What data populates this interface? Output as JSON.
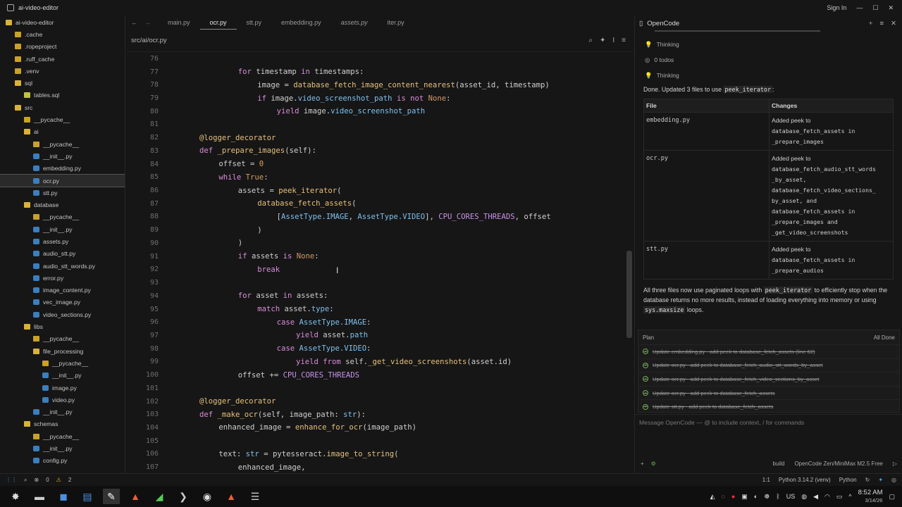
{
  "window": {
    "title": "ai-video-editor",
    "sign_in": "Sign In"
  },
  "sidebar": {
    "items": [
      {
        "label": "ai-video-editor",
        "indent": 0,
        "icon": "folder-open-icon"
      },
      {
        "label": ".cache",
        "indent": 1,
        "icon": "folder-icon"
      },
      {
        "label": ".ropeproject",
        "indent": 1,
        "icon": "folder-icon"
      },
      {
        "label": ".ruff_cache",
        "indent": 1,
        "icon": "folder-icon"
      },
      {
        "label": ".venv",
        "indent": 1,
        "icon": "folder-icon"
      },
      {
        "label": "sql",
        "indent": 1,
        "icon": "folder-open-icon"
      },
      {
        "label": "tables.sql",
        "indent": 2,
        "icon": "sql-file-icon"
      },
      {
        "label": "src",
        "indent": 1,
        "icon": "folder-open-icon"
      },
      {
        "label": "__pycache__",
        "indent": 2,
        "icon": "folder-icon"
      },
      {
        "label": "ai",
        "indent": 2,
        "icon": "folder-open-icon"
      },
      {
        "label": "__pycache__",
        "indent": 3,
        "icon": "folder-icon"
      },
      {
        "label": "__init__.py",
        "indent": 3,
        "icon": "python-file-icon"
      },
      {
        "label": "embedding.py",
        "indent": 3,
        "icon": "python-file-icon"
      },
      {
        "label": "ocr.py",
        "indent": 3,
        "icon": "python-file-icon",
        "selected": true
      },
      {
        "label": "stt.py",
        "indent": 3,
        "icon": "python-file-icon"
      },
      {
        "label": "database",
        "indent": 2,
        "icon": "folder-open-icon"
      },
      {
        "label": "__pycache__",
        "indent": 3,
        "icon": "folder-icon"
      },
      {
        "label": "__init__.py",
        "indent": 3,
        "icon": "python-file-icon"
      },
      {
        "label": "assets.py",
        "indent": 3,
        "icon": "python-file-icon"
      },
      {
        "label": "audio_stt.py",
        "indent": 3,
        "icon": "python-file-icon"
      },
      {
        "label": "audio_stt_words.py",
        "indent": 3,
        "icon": "python-file-icon"
      },
      {
        "label": "error.py",
        "indent": 3,
        "icon": "python-file-icon"
      },
      {
        "label": "image_content.py",
        "indent": 3,
        "icon": "python-file-icon"
      },
      {
        "label": "vec_image.py",
        "indent": 3,
        "icon": "python-file-icon"
      },
      {
        "label": "video_sections.py",
        "indent": 3,
        "icon": "python-file-icon"
      },
      {
        "label": "libs",
        "indent": 2,
        "icon": "folder-open-icon"
      },
      {
        "label": "__pycache__",
        "indent": 3,
        "icon": "folder-icon"
      },
      {
        "label": "file_processing",
        "indent": 3,
        "icon": "folder-open-icon"
      },
      {
        "label": "__pycache__",
        "indent": 4,
        "icon": "folder-icon"
      },
      {
        "label": "__init__.py",
        "indent": 4,
        "icon": "python-file-icon"
      },
      {
        "label": "image.py",
        "indent": 4,
        "icon": "python-file-icon"
      },
      {
        "label": "video.py",
        "indent": 4,
        "icon": "python-file-icon"
      },
      {
        "label": "__init__.py",
        "indent": 3,
        "icon": "python-file-icon"
      },
      {
        "label": "schemas",
        "indent": 2,
        "icon": "folder-open-icon"
      },
      {
        "label": "__pycache__",
        "indent": 3,
        "icon": "folder-icon"
      },
      {
        "label": "__init__.py",
        "indent": 3,
        "icon": "python-file-icon"
      },
      {
        "label": "config.py",
        "indent": 3,
        "icon": "python-file-icon"
      }
    ]
  },
  "tabs": [
    {
      "label": "main.py",
      "active": false,
      "italic": false
    },
    {
      "label": "ocr.py",
      "active": true,
      "italic": false
    },
    {
      "label": "stt.py",
      "active": false,
      "italic": false
    },
    {
      "label": "embedding.py",
      "active": false,
      "italic": false
    },
    {
      "label": "assets.py",
      "active": false,
      "italic": true
    },
    {
      "label": "iter.py",
      "active": false,
      "italic": false
    }
  ],
  "breadcrumb": "src/ai/ocr.py",
  "code": [
    {
      "n": "76",
      "indent": 0,
      "tokens": []
    },
    {
      "n": "77",
      "indent": 3,
      "tokens": [
        [
          "k",
          "for "
        ],
        [
          "v",
          "timestamp "
        ],
        [
          "k",
          "in "
        ],
        [
          "v",
          "timestamps:"
        ]
      ]
    },
    {
      "n": "78",
      "indent": 4,
      "tokens": [
        [
          "v",
          "image = "
        ],
        [
          "f",
          "database_fetch_image_content_nearest"
        ],
        [
          "v",
          "(asset_id, timestamp)"
        ]
      ]
    },
    {
      "n": "79",
      "indent": 4,
      "tokens": [
        [
          "k",
          "if "
        ],
        [
          "v",
          "image."
        ],
        [
          "t",
          "video_screenshot_path "
        ],
        [
          "k",
          "is not "
        ],
        [
          "c",
          "None"
        ],
        [
          "v",
          ":"
        ]
      ]
    },
    {
      "n": "80",
      "indent": 5,
      "tokens": [
        [
          "k",
          "yield "
        ],
        [
          "v",
          "image."
        ],
        [
          "t",
          "video_screenshot_path"
        ]
      ]
    },
    {
      "n": "81",
      "indent": 0,
      "tokens": []
    },
    {
      "n": "82",
      "indent": 1,
      "tokens": [
        [
          "d",
          "@logger_decorator"
        ]
      ]
    },
    {
      "n": "83",
      "indent": 1,
      "tokens": [
        [
          "k",
          "def "
        ],
        [
          "f",
          "_prepare_images"
        ],
        [
          "v",
          "(self):"
        ]
      ]
    },
    {
      "n": "84",
      "indent": 2,
      "tokens": [
        [
          "v",
          "offset = "
        ],
        [
          "n",
          "0"
        ]
      ]
    },
    {
      "n": "85",
      "indent": 2,
      "tokens": [
        [
          "k",
          "while "
        ],
        [
          "c",
          "True"
        ],
        [
          "v",
          ":"
        ]
      ]
    },
    {
      "n": "86",
      "indent": 3,
      "tokens": [
        [
          "v",
          "assets = "
        ],
        [
          "f",
          "peek_iterator"
        ],
        [
          "v",
          "("
        ]
      ]
    },
    {
      "n": "87",
      "indent": 4,
      "tokens": [
        [
          "f",
          "database_fetch_assets"
        ],
        [
          "v",
          "("
        ]
      ]
    },
    {
      "n": "88",
      "indent": 5,
      "tokens": [
        [
          "v",
          "["
        ],
        [
          "t",
          "AssetType.IMAGE"
        ],
        [
          "v",
          ", "
        ],
        [
          "t",
          "AssetType.VIDEO"
        ],
        [
          "v",
          "], "
        ],
        [
          "p",
          "CPU_CORES_THREADS"
        ],
        [
          "v",
          ", offset"
        ]
      ]
    },
    {
      "n": "89",
      "indent": 4,
      "tokens": [
        [
          "v",
          ")"
        ]
      ]
    },
    {
      "n": "90",
      "indent": 3,
      "tokens": [
        [
          "v",
          ")"
        ]
      ]
    },
    {
      "n": "91",
      "indent": 3,
      "tokens": [
        [
          "k",
          "if "
        ],
        [
          "v",
          "assets "
        ],
        [
          "k",
          "is "
        ],
        [
          "c",
          "None"
        ],
        [
          "v",
          ":"
        ]
      ]
    },
    {
      "n": "92",
      "indent": 4,
      "tokens": [
        [
          "k",
          "break"
        ]
      ]
    },
    {
      "n": "93",
      "indent": 0,
      "tokens": []
    },
    {
      "n": "94",
      "indent": 3,
      "tokens": [
        [
          "k",
          "for "
        ],
        [
          "v",
          "asset "
        ],
        [
          "k",
          "in "
        ],
        [
          "v",
          "assets:"
        ]
      ]
    },
    {
      "n": "95",
      "indent": 4,
      "tokens": [
        [
          "k",
          "match "
        ],
        [
          "v",
          "asset."
        ],
        [
          "t",
          "type"
        ],
        [
          "v",
          ":"
        ]
      ]
    },
    {
      "n": "96",
      "indent": 5,
      "tokens": [
        [
          "k",
          "case "
        ],
        [
          "t",
          "AssetType.IMAGE"
        ],
        [
          "v",
          ":"
        ]
      ]
    },
    {
      "n": "97",
      "indent": 6,
      "tokens": [
        [
          "k",
          "yield "
        ],
        [
          "v",
          "asset."
        ],
        [
          "t",
          "path"
        ]
      ]
    },
    {
      "n": "98",
      "indent": 5,
      "tokens": [
        [
          "k",
          "case "
        ],
        [
          "t",
          "AssetType.VIDEO"
        ],
        [
          "v",
          ":"
        ]
      ]
    },
    {
      "n": "99",
      "indent": 6,
      "tokens": [
        [
          "k",
          "yield from "
        ],
        [
          "v",
          "self."
        ],
        [
          "f",
          "_get_video_screenshots"
        ],
        [
          "v",
          "(asset.id)"
        ]
      ]
    },
    {
      "n": "100",
      "indent": 3,
      "tokens": [
        [
          "v",
          "offset += "
        ],
        [
          "p",
          "CPU_CORES_THREADS"
        ]
      ]
    },
    {
      "n": "101",
      "indent": 0,
      "tokens": []
    },
    {
      "n": "102",
      "indent": 1,
      "tokens": [
        [
          "d",
          "@logger_decorator"
        ]
      ]
    },
    {
      "n": "103",
      "indent": 1,
      "tokens": [
        [
          "k",
          "def "
        ],
        [
          "f",
          "_make_ocr"
        ],
        [
          "v",
          "(self, image_path: "
        ],
        [
          "t",
          "str"
        ],
        [
          "v",
          "):"
        ]
      ]
    },
    {
      "n": "104",
      "indent": 2,
      "tokens": [
        [
          "v",
          "enhanced_image = "
        ],
        [
          "f",
          "enhance_for_ocr"
        ],
        [
          "v",
          "(image_path)"
        ]
      ]
    },
    {
      "n": "105",
      "indent": 0,
      "tokens": []
    },
    {
      "n": "106",
      "indent": 2,
      "tokens": [
        [
          "v",
          "text: "
        ],
        [
          "t",
          "str"
        ],
        [
          "v",
          " = pytesseract."
        ],
        [
          "f",
          "image_to_string"
        ],
        [
          "v",
          "("
        ]
      ]
    },
    {
      "n": "107",
      "indent": 3,
      "tokens": [
        [
          "v",
          "enhanced_image,"
        ]
      ]
    }
  ],
  "panel": {
    "title": "OpenCode",
    "thinking1": "Thinking",
    "todos": "0 todos",
    "thinking2": "Thinking",
    "done_pre": "Done. Updated 3 files to use ",
    "done_code": "peek_iterator",
    "done_post": ":",
    "table_headers": [
      "File",
      "Changes"
    ],
    "rows": [
      {
        "file": "embedding.py",
        "changes": [
          "Added peek to",
          "database_fetch_assets in",
          "_prepare_images"
        ]
      },
      {
        "file": "ocr.py",
        "changes": [
          "Added peek to",
          "database_fetch_audio_stt_words",
          "_by_asset,",
          "database_fetch_video_sections_",
          "by_asset, and",
          "database_fetch_assets in",
          "_prepare_images and",
          "_get_video_screenshots"
        ]
      },
      {
        "file": "stt.py",
        "changes": [
          "Added peek to",
          "database_fetch_assets in",
          "_prepare_audios"
        ]
      }
    ],
    "summary1": "All three files now use paginated loops with ",
    "summary_code1": "peek_iterator",
    "summary2": " to efficiently stop when the database returns no more results, instead of loading everything into memory or using ",
    "summary_code2": "sys.maxsize",
    "summary3": " loops.",
    "plan_title": "Plan",
    "plan_status": "All Done",
    "plan_items": [
      "Update embedding.py - add peek to database_fetch_assets (line 62)",
      "Update ocr.py - add peek to database_fetch_audio_stt_words_by_asset",
      "Update ocr.py - add peek to database_fetch_video_sections_by_asset",
      "Update ocr.py - add peek to database_fetch_assets",
      "Update stt.py - add peek to database_fetch_assets"
    ],
    "input_placeholder": "Message OpenCode — @ to include context, / for commands",
    "footer_mode": "build",
    "footer_model": "OpenCode Zen/MiniMax M2.5 Free"
  },
  "statusbar": {
    "errors": "0",
    "warnings": "2",
    "position": "1:1",
    "python_env": "Python 3.14.2 (venv)",
    "language": "Python"
  },
  "tray": {
    "lang": "US",
    "time": "8:52 AM",
    "date": "3/14/26"
  }
}
